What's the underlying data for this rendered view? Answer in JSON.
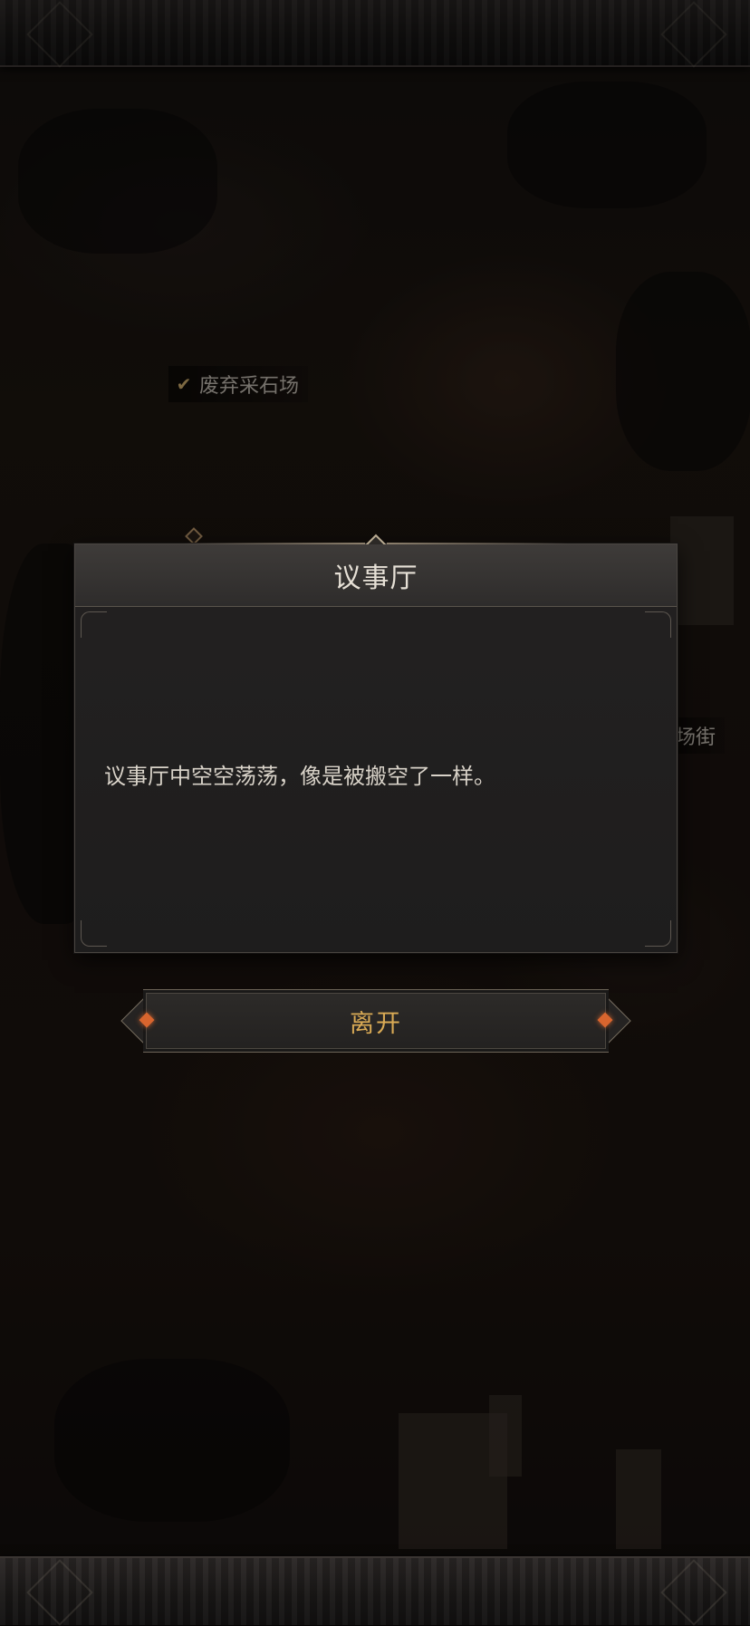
{
  "map": {
    "location_labels": {
      "quarry": "废弃采石场",
      "street": "场街"
    },
    "quarry_status_icon": "check-icon"
  },
  "dialog": {
    "title": "议事厅",
    "message": "议事厅中空空荡荡，像是被搬空了一样。"
  },
  "actions": {
    "leave_label": "离开"
  },
  "colors": {
    "accent_gold": "#d9aa55",
    "gem_orange": "#d8652e",
    "panel_bg": "#1e1d1d",
    "text_light": "#e6e0d6"
  }
}
